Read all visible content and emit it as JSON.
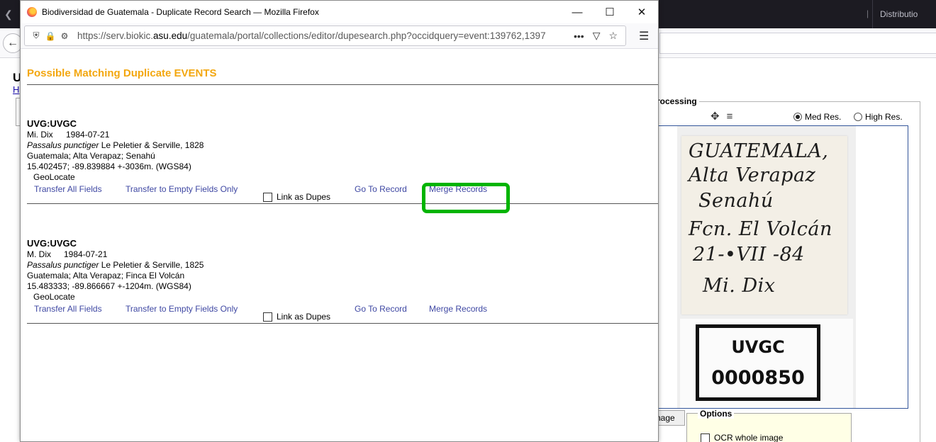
{
  "background": {
    "tab_right_label": "Distributio",
    "page_title_fragment": "U",
    "link_fragment": "H",
    "processing_legend": "rocessing",
    "res_med_label": "Med Res.",
    "res_high_label": "High Res.",
    "image_button_fragment": "nage",
    "options_legend": "Options",
    "ocr_label": "OCR whole image",
    "specimen_label_lines": [
      "GUATEMALA,",
      "Alta Verapaz",
      "Senahú",
      "Fcn. El Volcán",
      "21-•VII -84",
      "Mi. Dix"
    ],
    "specimen_code_lines": [
      "UVGC",
      "0000850"
    ]
  },
  "popup": {
    "window_title": "Biodiversidad de Guatemala - Duplicate Record Search — Mozilla Firefox",
    "url_prefix": "https://serv.biokic.",
    "url_domain": "asu.edu",
    "url_suffix": "/guatemala/portal/collections/editor/dupesearch.php?occidquery=event:139762,1397",
    "heading": "Possible Matching Duplicate EVENTS",
    "action_labels": {
      "transfer_all": "Transfer All Fields",
      "transfer_empty": "Transfer to Empty Fields Only",
      "link_dupes": "Link as Dupes",
      "go_to_record": "Go To Record",
      "merge_records": "Merge Records"
    },
    "records": [
      {
        "id": "UVG:UVGC",
        "collector": "Mi. Dix",
        "date": "1984-07-21",
        "sci_name": "Passalus punctiger",
        "author": "Le Peletier & Serville, 1828",
        "locality": "Guatemala; Alta Verapaz; Senahú",
        "coords": "15.402457; -89.839884 +-3036m. (WGS84)",
        "geolocate": "GeoLocate"
      },
      {
        "id": "UVG:UVGC",
        "collector": "M. Dix",
        "date": "1984-07-21",
        "sci_name": "Passalus punctiger",
        "author": "Le Peletier & Serville, 1825",
        "locality": "Guatemala; Alta Verapaz; Finca El Volcán",
        "coords": "15.483333; -89.866667 +-1204m. (WGS84)",
        "geolocate": "GeoLocate"
      }
    ]
  },
  "colors": {
    "heading": "#f3a70f",
    "link": "#3f48a3",
    "highlight": "#00b400"
  }
}
